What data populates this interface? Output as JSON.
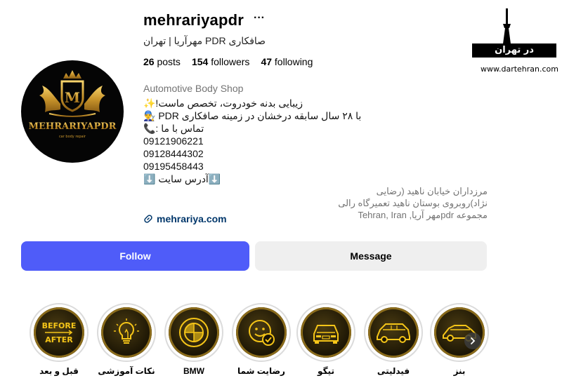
{
  "profile": {
    "username": "mehrariyapdr",
    "more_label": "···",
    "full_name": "صافکاری PDR مهرآریا | تهران",
    "stats": {
      "posts_count": "26",
      "posts_label": "posts",
      "followers_count": "154",
      "followers_label": "followers",
      "following_count": "47",
      "following_label": "following"
    },
    "category": "Automotive Body Shop",
    "bio_lines": [
      "زیبایی بدنه خودروت، تخصص ماست!✨",
      "با ۲۸ سال سابقه درخشان در زمینه صافکاری PDR 👨‍🔧",
      "تماس با ما :📞",
      "09121906221",
      "09128444302",
      "09195458443",
      "⬇️آدرس سایت ⬇️"
    ],
    "address": "مرزداران خیابان ناهید (رضایی نژاد)روبروی بوستان ناهید تعمیرگاه رالی مجموعه pdrمهر آریا, Tehran, Iran",
    "website": "mehrariya.com",
    "logo_text": "MEHRARIYAPDR",
    "logo_subtext": "car body repair"
  },
  "buttons": {
    "follow": "Follow",
    "message": "Message"
  },
  "highlights": [
    {
      "label": "قبل و بعد",
      "icon": "before-after-icon",
      "text1": "BEFORE",
      "text2": "AFTER"
    },
    {
      "label": "نکات آموزشی",
      "icon": "lightbulb-icon"
    },
    {
      "label": "BMW",
      "icon": "bmw-logo-icon"
    },
    {
      "label": "رضایت شما",
      "icon": "smiley-check-icon"
    },
    {
      "label": "تیگو",
      "icon": "car-front-icon"
    },
    {
      "label": "فیدلیتی",
      "icon": "suv-icon"
    },
    {
      "label": "بنز",
      "icon": "sedan-icon"
    }
  ],
  "watermark": {
    "title": "در تهران",
    "url": "www.dartehran.com"
  },
  "colors": {
    "follow_button": "#4f5cf9",
    "message_button": "#efefef",
    "link": "#00376b",
    "gold": "#f5c518",
    "muted": "#737373"
  }
}
